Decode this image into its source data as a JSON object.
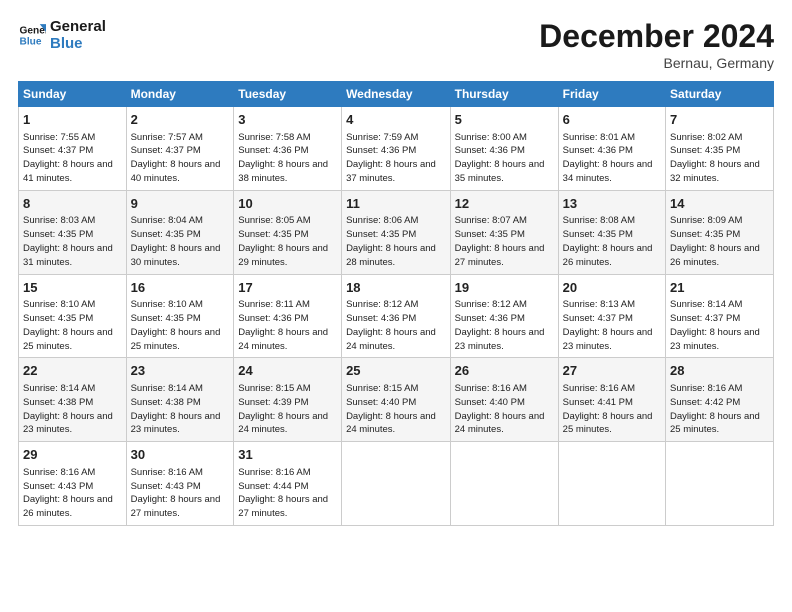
{
  "header": {
    "logo_line1": "General",
    "logo_line2": "Blue",
    "month": "December 2024",
    "location": "Bernau, Germany"
  },
  "weekdays": [
    "Sunday",
    "Monday",
    "Tuesday",
    "Wednesday",
    "Thursday",
    "Friday",
    "Saturday"
  ],
  "weeks": [
    [
      {
        "day": "1",
        "sunrise": "7:55 AM",
        "sunset": "4:37 PM",
        "daylight": "8 hours and 41 minutes."
      },
      {
        "day": "2",
        "sunrise": "7:57 AM",
        "sunset": "4:37 PM",
        "daylight": "8 hours and 40 minutes."
      },
      {
        "day": "3",
        "sunrise": "7:58 AM",
        "sunset": "4:36 PM",
        "daylight": "8 hours and 38 minutes."
      },
      {
        "day": "4",
        "sunrise": "7:59 AM",
        "sunset": "4:36 PM",
        "daylight": "8 hours and 37 minutes."
      },
      {
        "day": "5",
        "sunrise": "8:00 AM",
        "sunset": "4:36 PM",
        "daylight": "8 hours and 35 minutes."
      },
      {
        "day": "6",
        "sunrise": "8:01 AM",
        "sunset": "4:36 PM",
        "daylight": "8 hours and 34 minutes."
      },
      {
        "day": "7",
        "sunrise": "8:02 AM",
        "sunset": "4:35 PM",
        "daylight": "8 hours and 32 minutes."
      }
    ],
    [
      {
        "day": "8",
        "sunrise": "8:03 AM",
        "sunset": "4:35 PM",
        "daylight": "8 hours and 31 minutes."
      },
      {
        "day": "9",
        "sunrise": "8:04 AM",
        "sunset": "4:35 PM",
        "daylight": "8 hours and 30 minutes."
      },
      {
        "day": "10",
        "sunrise": "8:05 AM",
        "sunset": "4:35 PM",
        "daylight": "8 hours and 29 minutes."
      },
      {
        "day": "11",
        "sunrise": "8:06 AM",
        "sunset": "4:35 PM",
        "daylight": "8 hours and 28 minutes."
      },
      {
        "day": "12",
        "sunrise": "8:07 AM",
        "sunset": "4:35 PM",
        "daylight": "8 hours and 27 minutes."
      },
      {
        "day": "13",
        "sunrise": "8:08 AM",
        "sunset": "4:35 PM",
        "daylight": "8 hours and 26 minutes."
      },
      {
        "day": "14",
        "sunrise": "8:09 AM",
        "sunset": "4:35 PM",
        "daylight": "8 hours and 26 minutes."
      }
    ],
    [
      {
        "day": "15",
        "sunrise": "8:10 AM",
        "sunset": "4:35 PM",
        "daylight": "8 hours and 25 minutes."
      },
      {
        "day": "16",
        "sunrise": "8:10 AM",
        "sunset": "4:35 PM",
        "daylight": "8 hours and 25 minutes."
      },
      {
        "day": "17",
        "sunrise": "8:11 AM",
        "sunset": "4:36 PM",
        "daylight": "8 hours and 24 minutes."
      },
      {
        "day": "18",
        "sunrise": "8:12 AM",
        "sunset": "4:36 PM",
        "daylight": "8 hours and 24 minutes."
      },
      {
        "day": "19",
        "sunrise": "8:12 AM",
        "sunset": "4:36 PM",
        "daylight": "8 hours and 23 minutes."
      },
      {
        "day": "20",
        "sunrise": "8:13 AM",
        "sunset": "4:37 PM",
        "daylight": "8 hours and 23 minutes."
      },
      {
        "day": "21",
        "sunrise": "8:14 AM",
        "sunset": "4:37 PM",
        "daylight": "8 hours and 23 minutes."
      }
    ],
    [
      {
        "day": "22",
        "sunrise": "8:14 AM",
        "sunset": "4:38 PM",
        "daylight": "8 hours and 23 minutes."
      },
      {
        "day": "23",
        "sunrise": "8:14 AM",
        "sunset": "4:38 PM",
        "daylight": "8 hours and 23 minutes."
      },
      {
        "day": "24",
        "sunrise": "8:15 AM",
        "sunset": "4:39 PM",
        "daylight": "8 hours and 24 minutes."
      },
      {
        "day": "25",
        "sunrise": "8:15 AM",
        "sunset": "4:40 PM",
        "daylight": "8 hours and 24 minutes."
      },
      {
        "day": "26",
        "sunrise": "8:16 AM",
        "sunset": "4:40 PM",
        "daylight": "8 hours and 24 minutes."
      },
      {
        "day": "27",
        "sunrise": "8:16 AM",
        "sunset": "4:41 PM",
        "daylight": "8 hours and 25 minutes."
      },
      {
        "day": "28",
        "sunrise": "8:16 AM",
        "sunset": "4:42 PM",
        "daylight": "8 hours and 25 minutes."
      }
    ],
    [
      {
        "day": "29",
        "sunrise": "8:16 AM",
        "sunset": "4:43 PM",
        "daylight": "8 hours and 26 minutes."
      },
      {
        "day": "30",
        "sunrise": "8:16 AM",
        "sunset": "4:43 PM",
        "daylight": "8 hours and 27 minutes."
      },
      {
        "day": "31",
        "sunrise": "8:16 AM",
        "sunset": "4:44 PM",
        "daylight": "8 hours and 27 minutes."
      },
      null,
      null,
      null,
      null
    ]
  ],
  "labels": {
    "sunrise": "Sunrise:",
    "sunset": "Sunset:",
    "daylight": "Daylight:"
  }
}
